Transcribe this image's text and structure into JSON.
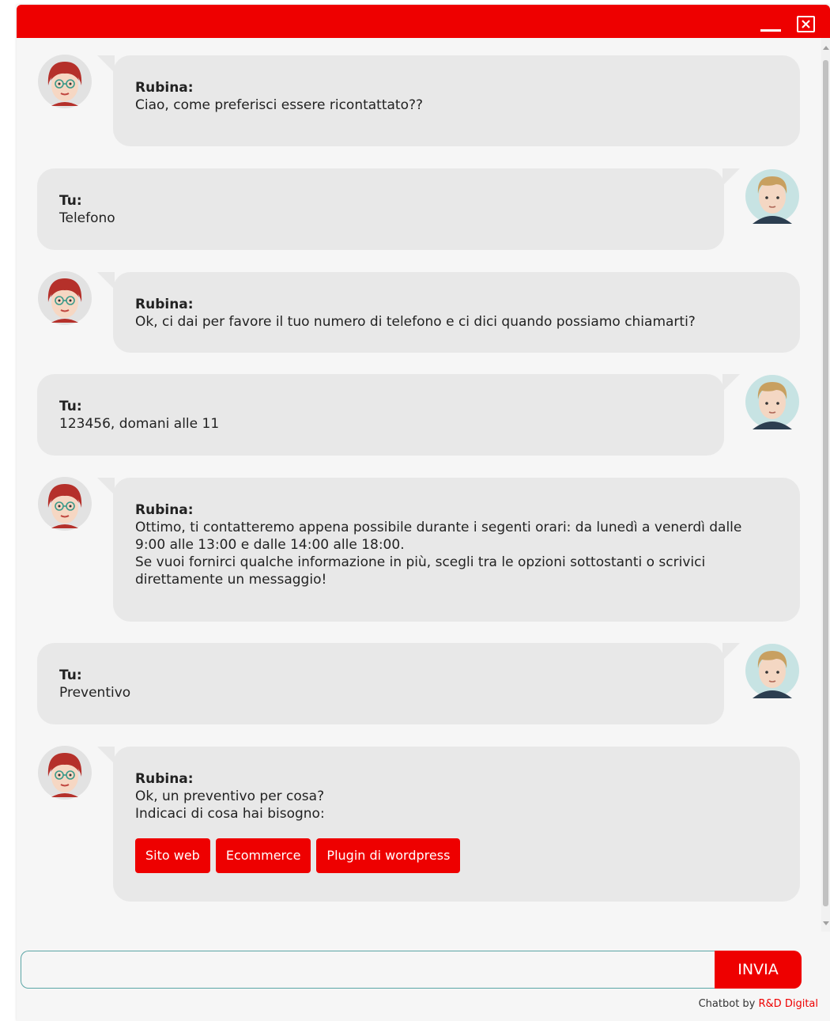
{
  "window": {
    "minimize_icon": "minimize-icon",
    "close_icon": "close-box-icon",
    "accent_color": "#ee0000"
  },
  "messages": [
    {
      "role": "bot",
      "sender": "Rubina:",
      "text": "Ciao, come preferisci essere ricontattato??"
    },
    {
      "role": "user",
      "sender": "Tu:",
      "text": "Telefono"
    },
    {
      "role": "bot",
      "sender": "Rubina:",
      "text": "Ok, ci dai per favore il tuo numero di telefono e ci dici quando possiamo chiamarti?"
    },
    {
      "role": "user",
      "sender": "Tu:",
      "text": "123456, domani alle 11"
    },
    {
      "role": "bot",
      "sender": "Rubina:",
      "text": "Ottimo, ti contatteremo appena possibile durante i segenti orari: da lunedì a venerdì dalle\n9:00 alle 13:00 e dalle 14:00 alle 18:00.\nSe vuoi fornirci qualche informazione in più, scegli tra le opzioni sottostanti o scrivici\ndirettamente un messaggio!"
    },
    {
      "role": "user",
      "sender": "Tu:",
      "text": "Preventivo"
    },
    {
      "role": "bot",
      "sender": "Rubina:",
      "text": "Ok, un preventivo per cosa?\nIndicaci di cosa hai bisogno:"
    }
  ],
  "options": [
    "Sito web",
    "Ecommerce",
    "Plugin di wordpress"
  ],
  "composer": {
    "input_value": "",
    "placeholder": "",
    "send_label": "INVIA"
  },
  "footer": {
    "prefix": "Chatbot by ",
    "brand": "R&D Digital"
  }
}
